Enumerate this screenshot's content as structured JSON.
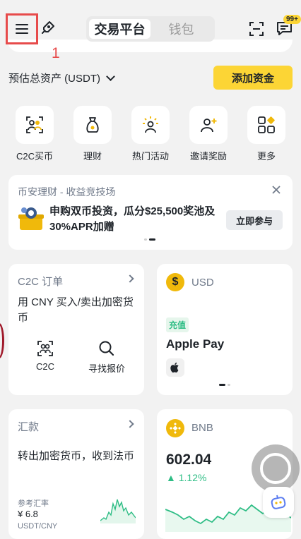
{
  "header": {
    "tabs": [
      {
        "label": "交易平台",
        "active": true
      },
      {
        "label": "钱包",
        "active": false
      }
    ],
    "badge": "99+",
    "annotation_number": "1"
  },
  "assets": {
    "label": "预估总资产 (USDT)",
    "add_funds": "添加资金"
  },
  "shortcuts": [
    {
      "label": "C2C买币",
      "icon": "c2c-people-icon"
    },
    {
      "label": "理财",
      "icon": "money-bag-icon"
    },
    {
      "label": "热门活动",
      "icon": "celebrate-icon"
    },
    {
      "label": "邀请奖励",
      "icon": "add-user-icon"
    },
    {
      "label": "更多",
      "icon": "grid-more-icon"
    }
  ],
  "promo": {
    "title": "币安理财 - 收益竞技场",
    "text": "申购双币投资，瓜分$25,500奖池及30%APR加赠",
    "button": "立即参与"
  },
  "c2c_card": {
    "title": "C2C 订单",
    "desc": "用 CNY 买入/卖出加密货币",
    "actions": [
      {
        "label": "C2C",
        "icon": "c2c-people-icon"
      },
      {
        "label": "寻找报价",
        "icon": "search-icon"
      }
    ]
  },
  "usd_card": {
    "coin": "USD",
    "symbol": "$",
    "tag": "充值",
    "method": "Apple Pay"
  },
  "fx_card": {
    "title": "汇款",
    "desc": "转出加密货币，收到法币",
    "rate_label": "参考汇率",
    "rate": "¥ 6.8",
    "pair": "USDT/CNY"
  },
  "bnb_card": {
    "coin": "BNB",
    "price": "602.04",
    "change": "1.12%"
  },
  "colors": {
    "accent": "#fcd535",
    "up": "#2ebd85",
    "annotation": "#e74b4b"
  }
}
